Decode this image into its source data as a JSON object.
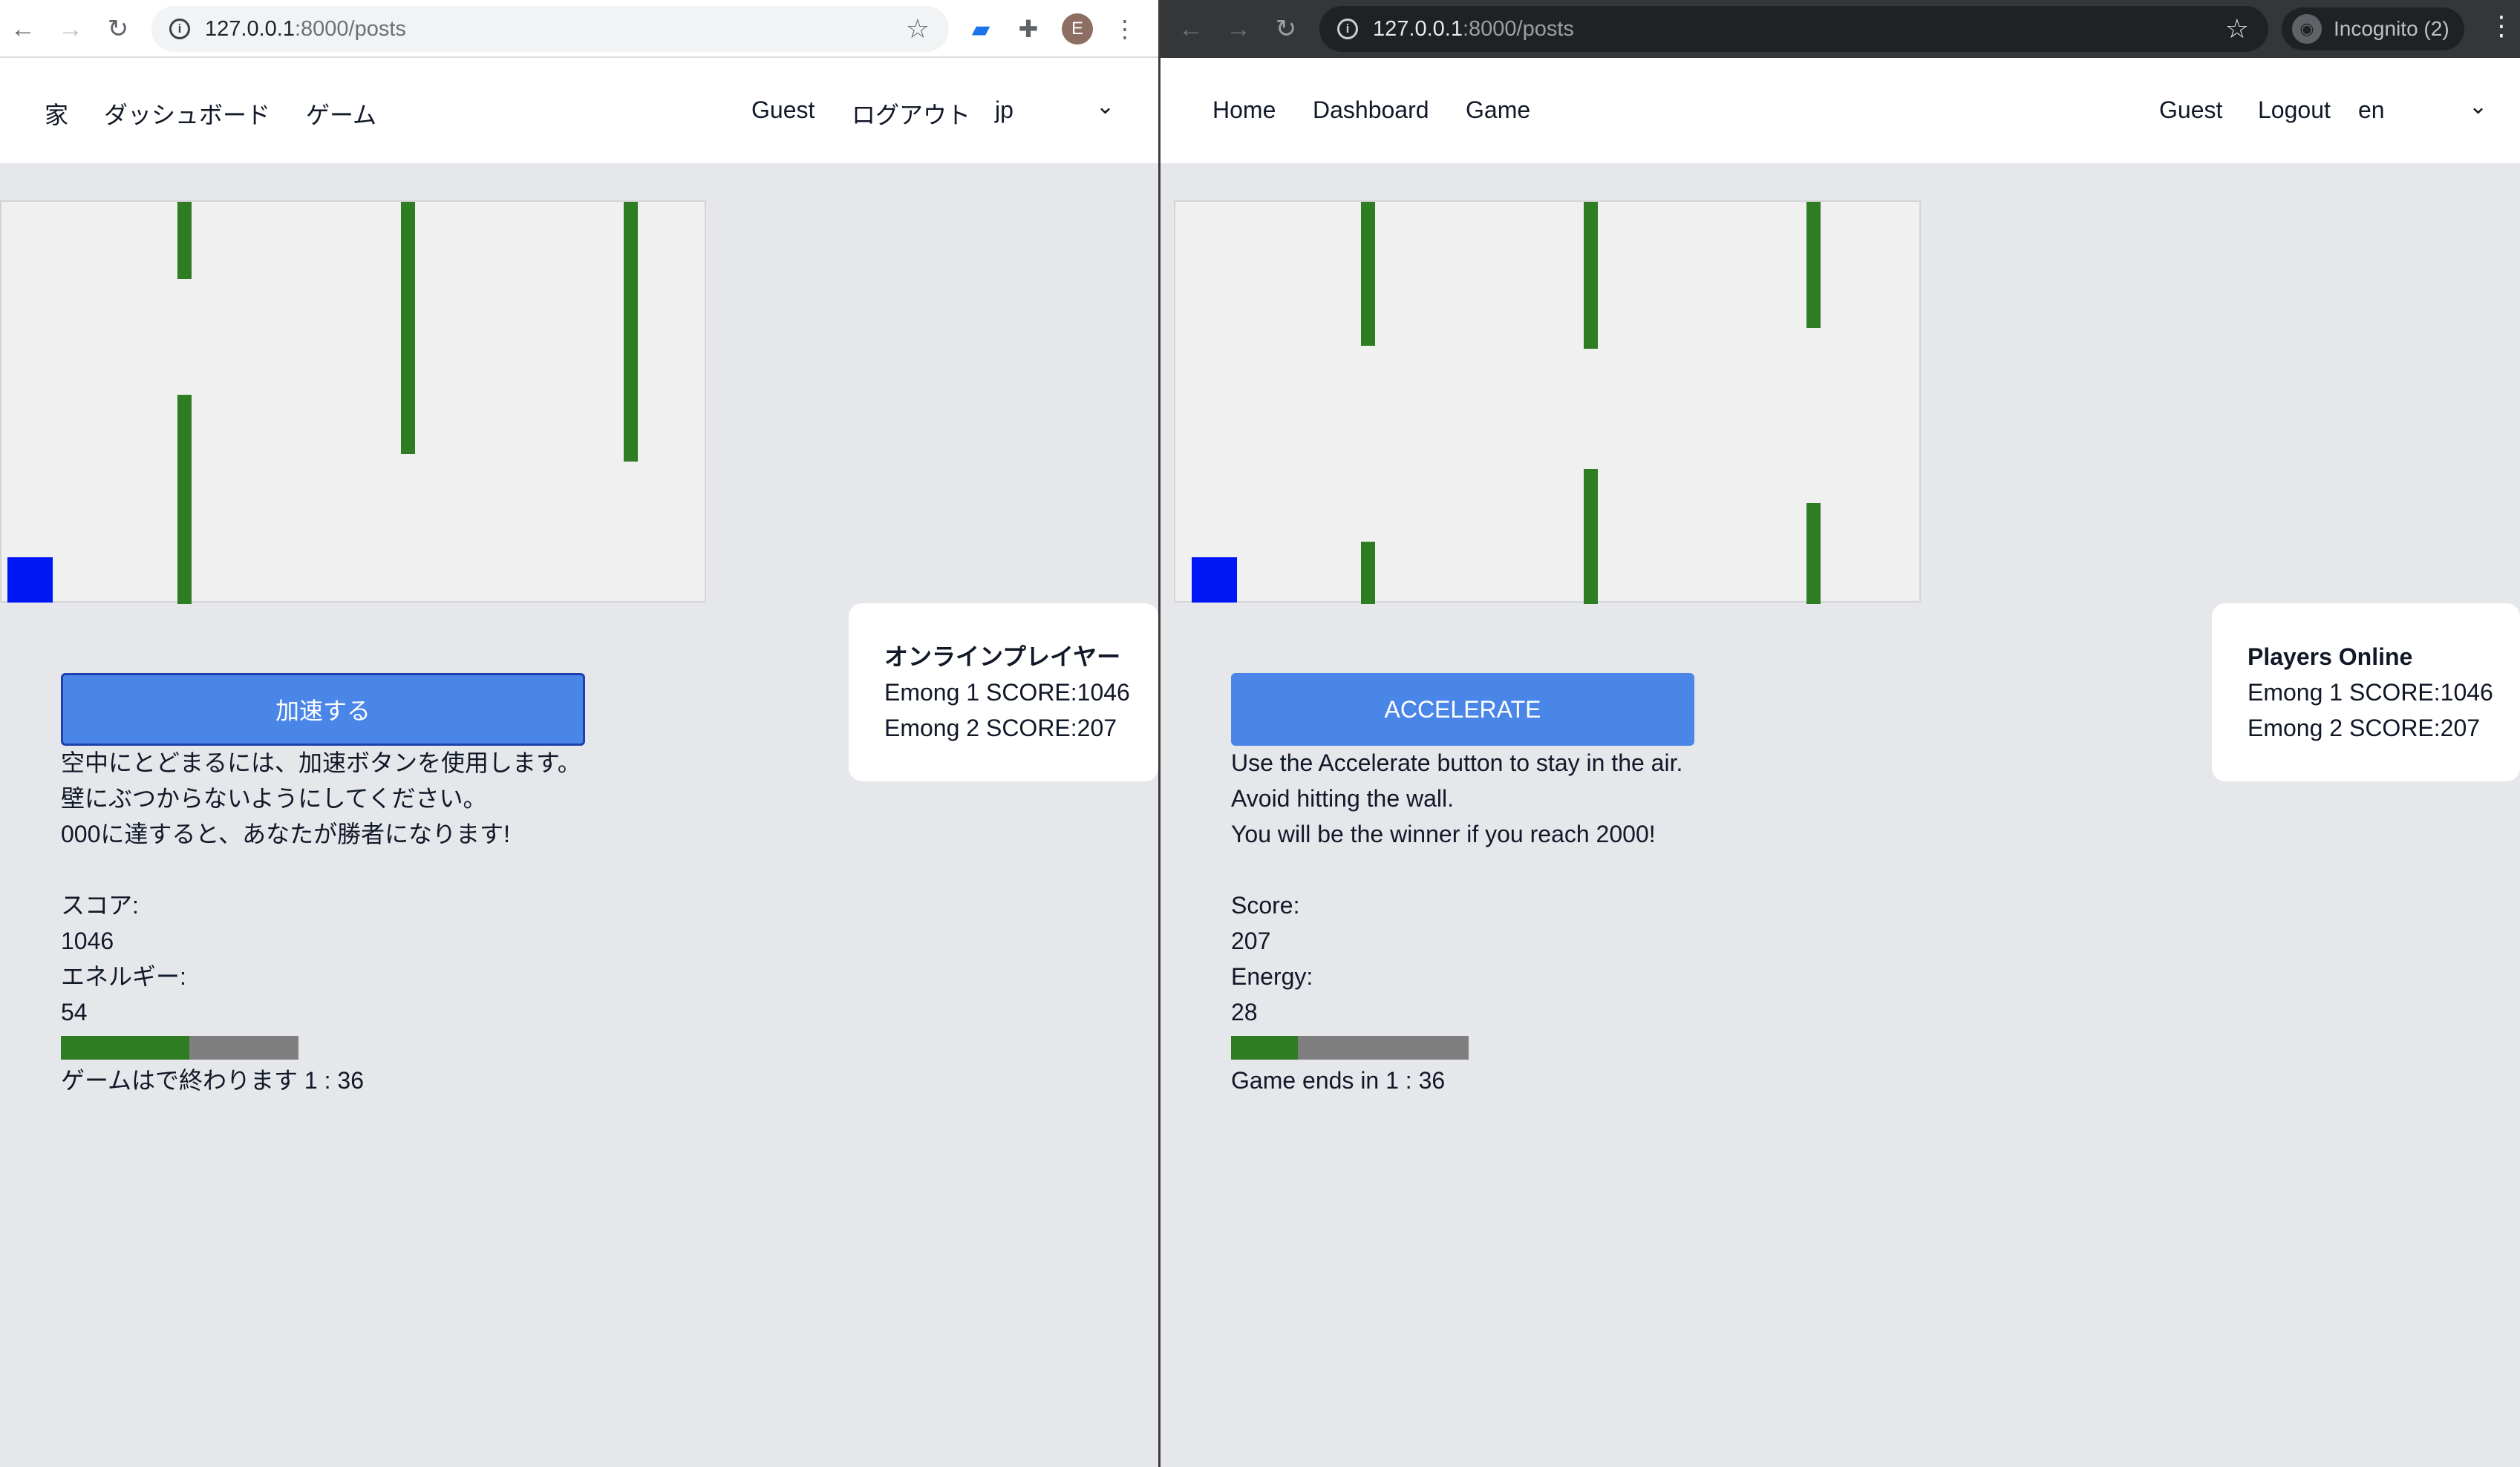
{
  "left": {
    "browser": {
      "url_host": "127.0.0.1",
      "url_path": ":8000/posts",
      "profile_initial": "E"
    },
    "nav": {
      "home": "家",
      "dashboard": "ダッシュボード",
      "game": "ゲーム",
      "user": "Guest",
      "logout": "ログアウト",
      "lang": "jp"
    },
    "game": {
      "accelerate": "加速する",
      "instructions": [
        "空中にとどまるには、加速ボタンを使用します。",
        "壁にぶつからないようにしてください。",
        "000に達すると、あなたが勝者になります!"
      ],
      "score_label": "スコア:",
      "score": "1046",
      "energy_label": "エネルギー:",
      "energy": "54",
      "energy_fraction": 0.54,
      "timer": "ゲームはで終わります 1 : 36"
    },
    "players": {
      "title": "オンラインプレイヤー",
      "list": [
        "Emong 1 SCORE:1046",
        "Emong 2 SCORE:207"
      ]
    }
  },
  "right": {
    "browser": {
      "url_host": "127.0.0.1",
      "url_path": ":8000/posts",
      "incognito": "Incognito (2)"
    },
    "nav": {
      "home": "Home",
      "dashboard": "Dashboard",
      "game": "Game",
      "user": "Guest",
      "logout": "Logout",
      "lang": "en"
    },
    "game": {
      "accelerate": "ACCELERATE",
      "instructions": [
        "Use the Accelerate button to stay in the air.",
        "Avoid hitting the wall.",
        "You will be the winner if you reach 2000!"
      ],
      "score_label": "Score:",
      "score": "207",
      "energy_label": "Energy:",
      "energy": "28",
      "energy_fraction": 0.28,
      "timer": "Game ends in 1 : 36"
    },
    "players": {
      "title": "Players Online",
      "list": [
        "Emong 1 SCORE:1046",
        "Emong 2 SCORE:207"
      ]
    }
  },
  "colors": {
    "pipe": "#2e7d23",
    "player": "#0017f5",
    "button": "#4a86e8",
    "energy_fill": "#2e7d23",
    "energy_track": "#7f7f7f"
  },
  "icons": [
    "back-arrow-icon",
    "forward-arrow-icon",
    "reload-icon",
    "info-icon",
    "star-icon",
    "extension-icon",
    "puzzle-icon",
    "kebab-menu-icon",
    "incognito-icon",
    "chevron-down-icon"
  ]
}
